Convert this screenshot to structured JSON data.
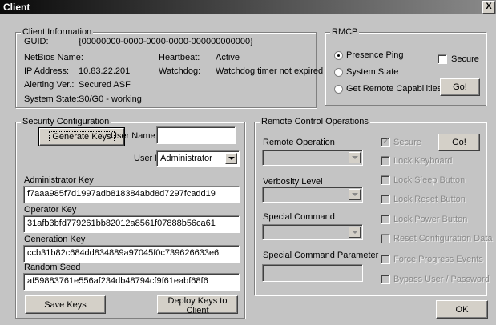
{
  "window": {
    "title": "Client",
    "close_glyph": "X"
  },
  "client_info": {
    "legend": "Client Information",
    "guid_label": "GUID:",
    "guid_value": "{00000000-0000-0000-0000-000000000000}",
    "netbios_label": "NetBios Name:",
    "netbios_value": "",
    "ip_label": "IP Address:",
    "ip_value": "10.83.22.201",
    "alerting_label": "Alerting Ver.:",
    "alerting_value": "Secured ASF",
    "system_state_label": "System State:",
    "system_state_value": "S0/G0 - working",
    "heartbeat_label": "Heartbeat:",
    "heartbeat_value": "Active",
    "watchdog_label": "Watchdog:",
    "watchdog_value": "Watchdog timer not expired"
  },
  "rmcp": {
    "legend": "RMCP",
    "presence_ping": "Presence Ping",
    "system_state": "System State",
    "get_capabilities": "Get Remote Capabilities",
    "secure": "Secure",
    "go": "Go!",
    "selected": "presence_ping"
  },
  "security": {
    "legend": "Security Configuration",
    "generate_keys": "Generate Keys",
    "user_name_label": "User Name",
    "user_name_value": "",
    "user_role_label": "User Role",
    "user_role_value": "Administrator",
    "admin_key_label": "Administrator Key",
    "admin_key_value": "f7aaa985f7d1997adb818384abd8d7297fcadd19",
    "operator_key_label": "Operator Key",
    "operator_key_value": "31afb3bfd779261bb82012a8561f07888b56ca61",
    "generation_key_label": "Generation Key",
    "generation_key_value": "ccb31b82c684dd834889a97045f0c739626633e6",
    "random_seed_label": "Random Seed",
    "random_seed_value": "af59883761e556af234db48794cf9f61eabf68f6",
    "save_keys": "Save Keys",
    "deploy_keys": "Deploy Keys to Client"
  },
  "remote_control": {
    "legend": "Remote Control Operations",
    "remote_operation_label": "Remote Operation",
    "verbosity_label": "Verbosity Level",
    "special_command_label": "Special Command",
    "special_param_label": "Special Command Parameter",
    "secure": "Secure",
    "go": "Go!",
    "lock_keyboard": "Lock Keyboard",
    "lock_sleep": "Lock Sleep Button",
    "lock_reset": "Lock Reset Button",
    "lock_power": "Lock Power Button",
    "reset_config": "Reset Configuration Data",
    "force_progress": "Force Progress Events",
    "bypass_user": "Bypass User / Password"
  },
  "footer": {
    "ok": "OK"
  }
}
